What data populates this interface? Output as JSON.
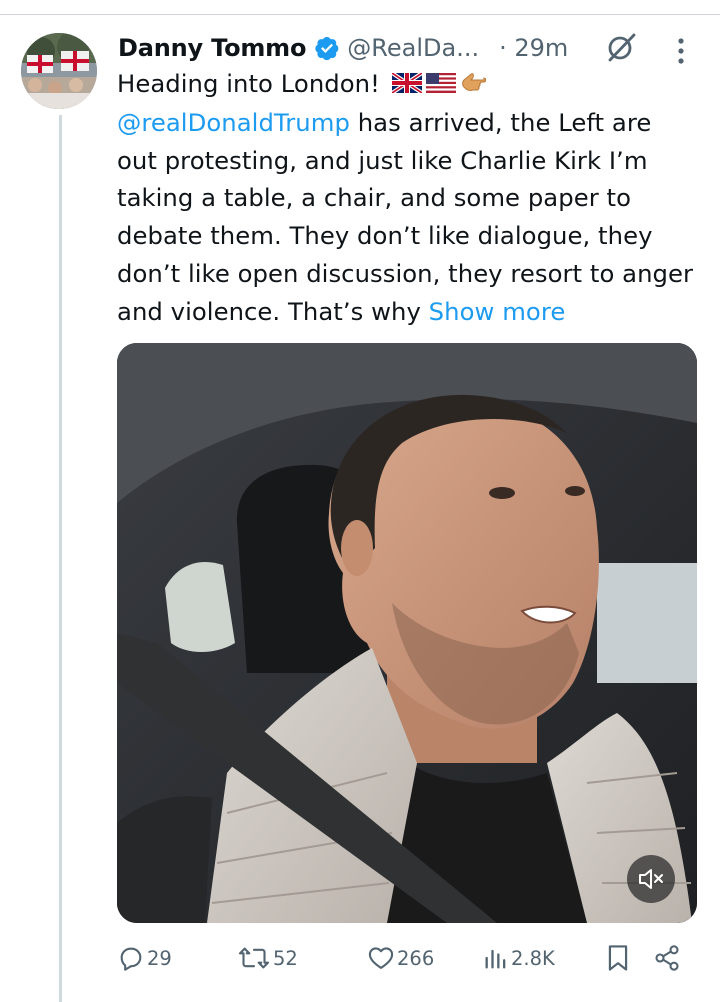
{
  "author": {
    "name": "Danny Tommo",
    "handle": "@RealDa...",
    "time": "· 29m"
  },
  "tweet": {
    "intro": "Heading into London! ",
    "mention": "@realDonaldTrump",
    "body": " has arrived, the Left are out protesting, and just like Charlie Kirk I’m taking a table, a chair, and some paper to debate them. They don’t like dialogue, they don’t like open discussion, they resort to anger and violence. That’s why ",
    "show_more": "Show more"
  },
  "actions": {
    "replies": "29",
    "reposts": "52",
    "likes": "266",
    "views": "2.8K"
  },
  "colors": {
    "accent": "#1d9bf0",
    "secondary_text": "#536471",
    "thread_line": "#cfd9de"
  },
  "icons": {
    "verified": "verified-badge-icon",
    "grok": "grok-icon",
    "more": "more-vertical-icon",
    "mute": "volume-muted-icon",
    "reply": "reply-icon",
    "repost": "repost-icon",
    "like": "heart-icon",
    "views": "views-icon",
    "bookmark": "bookmark-icon",
    "share": "share-icon"
  }
}
